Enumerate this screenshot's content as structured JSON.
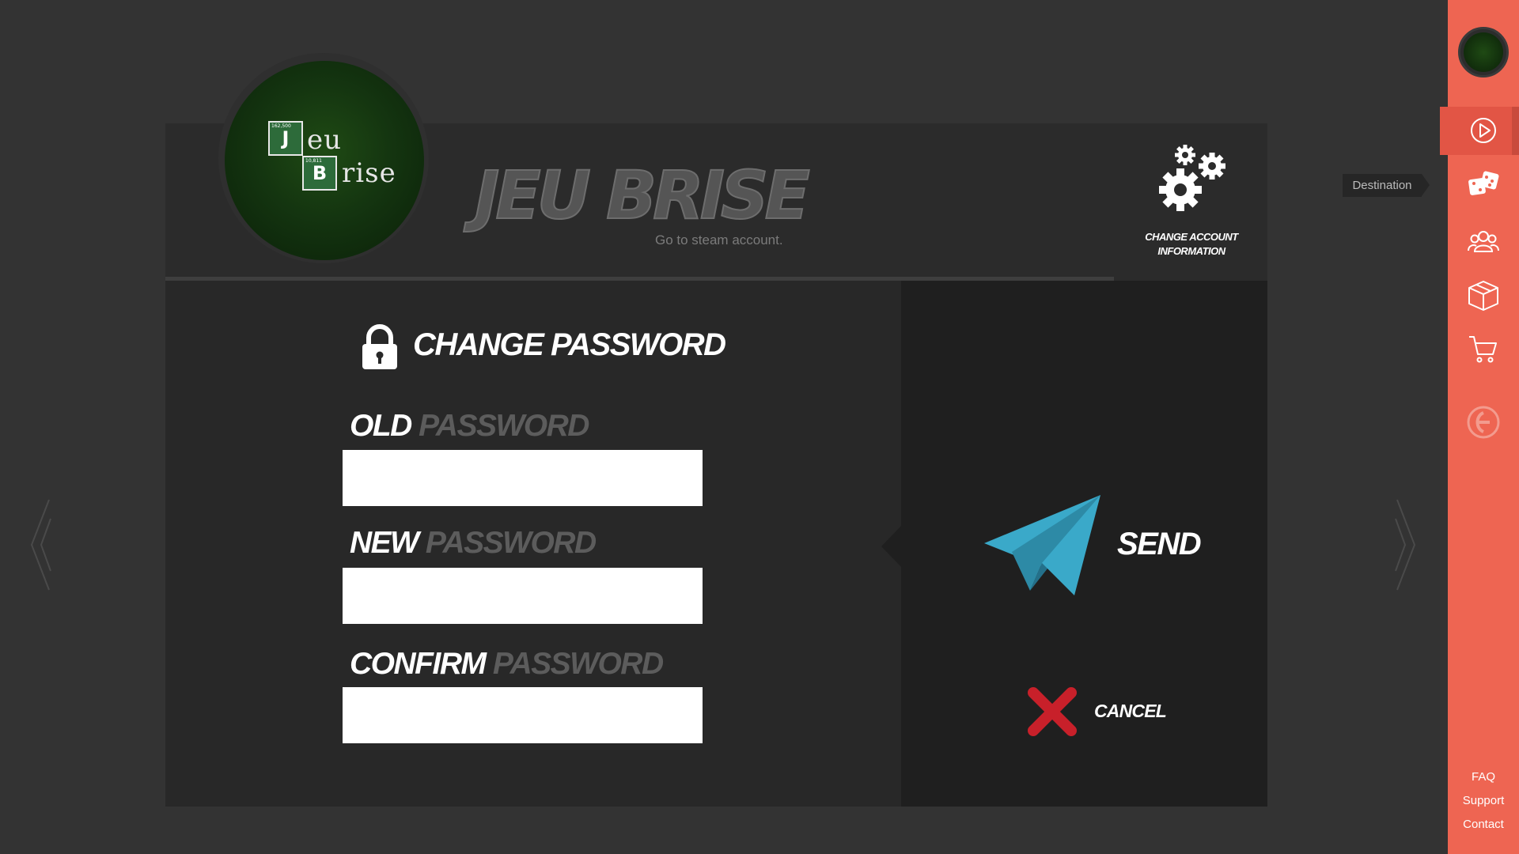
{
  "brand": {
    "title": "JEU BRISE",
    "link": "Go to steam account.",
    "logo_letter_1": "J",
    "logo_word_1": "eu",
    "logo_letter_2": "B",
    "logo_word_2": "rise",
    "logo_num_1": "162,500",
    "logo_num_2": "10,811"
  },
  "account": {
    "label_line1": "CHANGE ACCOUNT",
    "label_line2": "INFORMATION"
  },
  "form": {
    "title": "CHANGE PASSWORD",
    "fields": [
      {
        "word1": "OLD",
        "word2": "PASSWORD",
        "value": ""
      },
      {
        "word1": "NEW",
        "word2": "PASSWORD",
        "value": ""
      },
      {
        "word1": "CONFIRM",
        "word2": "PASSWORD",
        "value": ""
      }
    ]
  },
  "actions": {
    "send_label": "SEND",
    "cancel_label": "CANCEL"
  },
  "sidebar": {
    "tooltip": "Destination",
    "icons": [
      "play-icon",
      "dice-icon",
      "users-icon",
      "box-icon",
      "cart-icon",
      "logo-faded-icon"
    ],
    "links": [
      "FAQ",
      "Support",
      "Contact"
    ]
  },
  "colors": {
    "sidebar": "#ee6552",
    "send_icon": "#3aa9c9",
    "cancel_icon": "#c8202a",
    "background": "#333333"
  }
}
